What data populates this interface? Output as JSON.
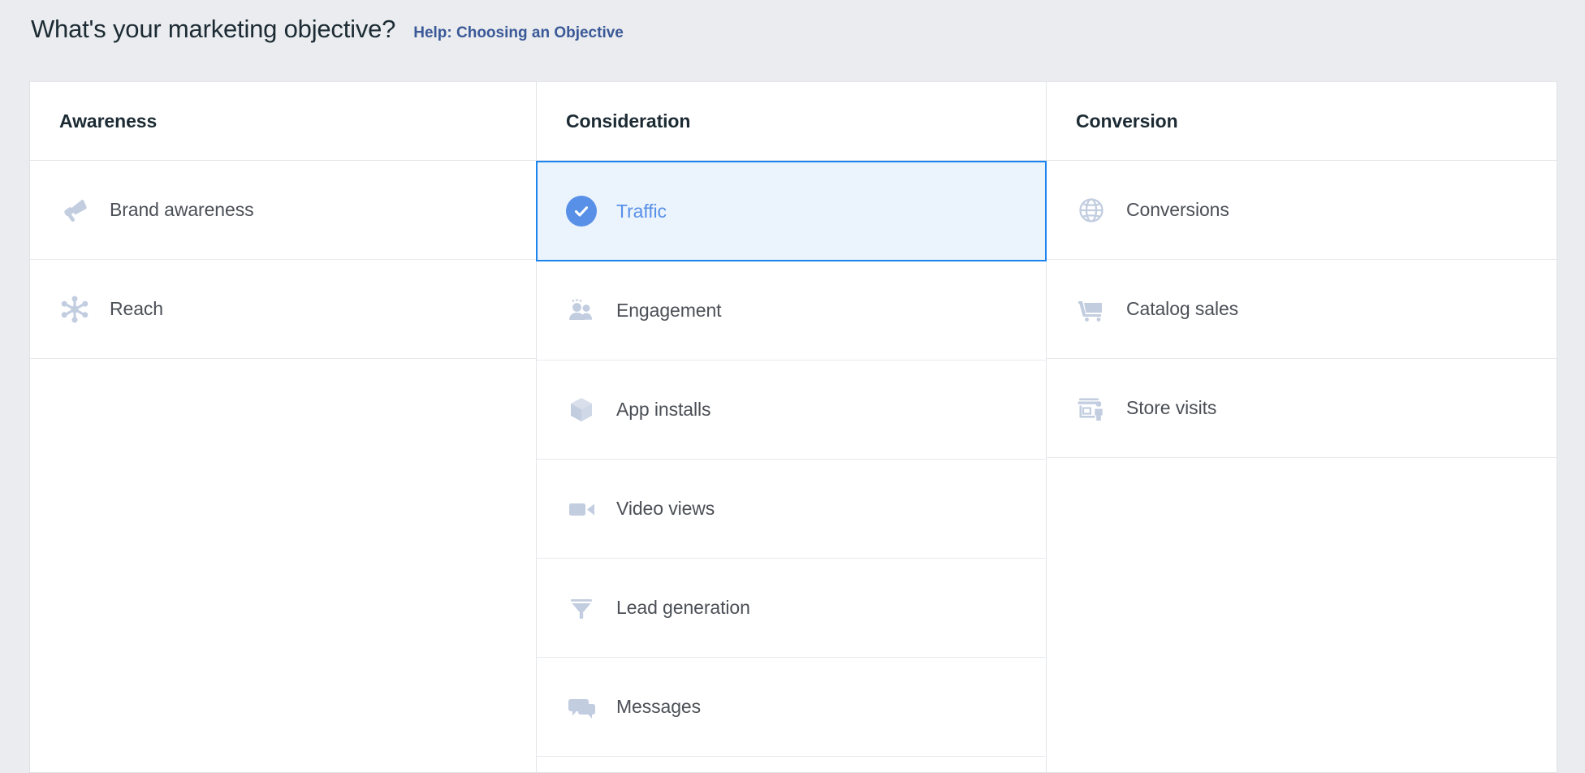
{
  "header": {
    "title": "What's your marketing objective?",
    "help_link": "Help: Choosing an Objective"
  },
  "colors": {
    "page_background": "#eaecef",
    "card_background": "#ffffff",
    "heading_text": "#1c2b33",
    "row_label_text": "#4b4f56",
    "link_blue": "#3b5998",
    "selected_border": "#1b84ee",
    "selected_background": "#ebf4fd",
    "selected_text": "#5890e8",
    "check_circle": "#5890e8",
    "icon_fill": "#c2cde0",
    "divider": "#e3e5e9"
  },
  "columns": [
    {
      "id": "awareness",
      "header": "Awareness",
      "rows": [
        {
          "label": "Brand awareness",
          "icon": "megaphone-icon",
          "selected": false
        },
        {
          "label": "Reach",
          "icon": "reach-nodes-icon",
          "selected": false
        }
      ]
    },
    {
      "id": "consideration",
      "header": "Consideration",
      "rows": [
        {
          "label": "Traffic",
          "icon": "check-circle-icon",
          "selected": true
        },
        {
          "label": "Engagement",
          "icon": "people-icon",
          "selected": false
        },
        {
          "label": "App installs",
          "icon": "cube-icon",
          "selected": false
        },
        {
          "label": "Video views",
          "icon": "video-camera-icon",
          "selected": false
        },
        {
          "label": "Lead generation",
          "icon": "funnel-icon",
          "selected": false
        },
        {
          "label": "Messages",
          "icon": "speech-bubbles-icon",
          "selected": false
        }
      ]
    },
    {
      "id": "conversion",
      "header": "Conversion",
      "rows": [
        {
          "label": "Conversions",
          "icon": "globe-icon",
          "selected": false
        },
        {
          "label": "Catalog sales",
          "icon": "shopping-cart-icon",
          "selected": false
        },
        {
          "label": "Store visits",
          "icon": "storefront-person-icon",
          "selected": false
        }
      ]
    }
  ]
}
